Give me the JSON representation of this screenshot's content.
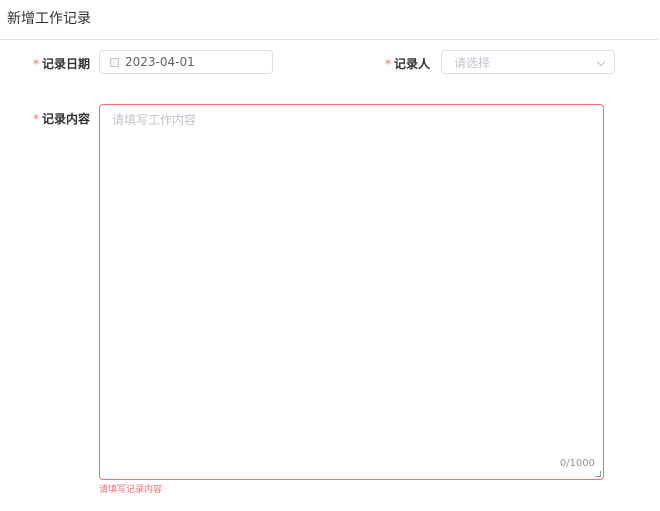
{
  "header": {
    "title": "新增工作记录"
  },
  "form": {
    "date": {
      "label": "记录日期",
      "required": "*",
      "value": "2023-04-01"
    },
    "recorder": {
      "label": "记录人",
      "required": "*",
      "placeholder": "请选择"
    },
    "content": {
      "label": "记录内容",
      "required": "*",
      "placeholder": "请填写工作内容",
      "count": "0/1000",
      "error": "请填写记录内容"
    }
  },
  "colors": {
    "error": "#f56c6c",
    "border": "#dcdfe6"
  }
}
